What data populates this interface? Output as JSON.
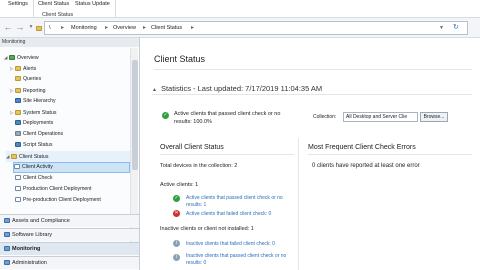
{
  "ribbon": {
    "settings_label": "Settings",
    "client_status_label": "Client Status",
    "status_update_label": "Status Update",
    "group_label": "Client Status"
  },
  "address": {
    "root": "\\",
    "crumbs": [
      "Monitoring",
      "Overview",
      "Client Status"
    ]
  },
  "nav": {
    "header": "Monitoring",
    "items": [
      {
        "label": "Overview"
      },
      {
        "label": "Alerts"
      },
      {
        "label": "Queries"
      },
      {
        "label": "Reporting"
      },
      {
        "label": "Site Hierarchy"
      },
      {
        "label": "System Status"
      },
      {
        "label": "Deployments"
      },
      {
        "label": "Client Operations"
      },
      {
        "label": "Script Status"
      },
      {
        "label": "Client Status"
      },
      {
        "label": "Client Activity"
      },
      {
        "label": "Client Check"
      },
      {
        "label": "Production Client Deployment"
      },
      {
        "label": "Pre-production Client Deployment"
      }
    ],
    "workspaces": [
      "Assets and Compliance",
      "Software Library",
      "Monitoring",
      "Administration"
    ]
  },
  "main": {
    "title": "Client Status",
    "stats_header": "Statistics - Last updated: 7/17/2019 11:04:35 AM",
    "summary_line1": "Active clients that passed client check or no",
    "summary_line2": "results: 100.0%",
    "collection_label": "Collection:",
    "collection_value": "All Desktop and Server Clie",
    "browse_label": "Browse...",
    "overall": {
      "heading": "Overall Client Status",
      "total": "Total devices in the collection: 2",
      "active": "Active clients: 1",
      "active_pass_l1": "Active clients that passed client check or no",
      "active_pass_l2": "results: 1",
      "active_fail": "Active clients that failed client check: 0",
      "inactive": "Inactive clients or client not installed: 1",
      "inactive_fail": "Inactive clients that failed client check: 0",
      "inactive_pass_l1": "Inactive clients that passed client check or no",
      "inactive_pass_l2": "results: 0"
    },
    "errors": {
      "heading": "Most Frequent Client Check Errors",
      "message": "0 clients have reported at least one error"
    }
  }
}
